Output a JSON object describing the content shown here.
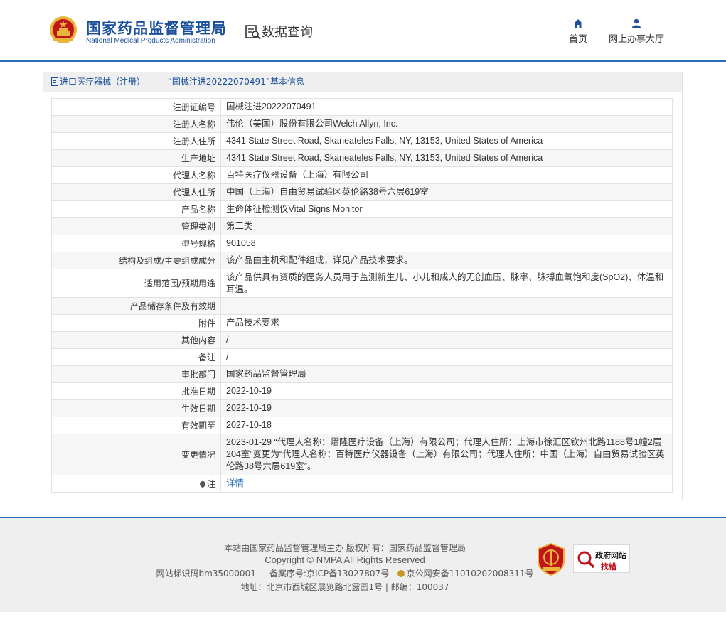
{
  "header": {
    "org_name_cn": "国家药品监督管理局",
    "org_name_en": "National Medical Products Administration",
    "section_title": "数据查询",
    "nav": {
      "home": "首页",
      "service_hall": "网上办事大厅"
    }
  },
  "panel": {
    "breadcrumb": "进口医疗器械（注册） —— “国械注进20222070491”基本信息"
  },
  "rows": [
    {
      "label": "注册证编号",
      "value": "国械注进20222070491"
    },
    {
      "label": "注册人名称",
      "value": "伟伦（美国）股份有限公司Welch Allyn, Inc."
    },
    {
      "label": "注册人住所",
      "value": "4341 State Street Road, Skaneateles Falls, NY, 13153, United States of America"
    },
    {
      "label": "生产地址",
      "value": "4341 State Street Road, Skaneateles Falls, NY, 13153, United States of America"
    },
    {
      "label": "代理人名称",
      "value": "百特医疗仪器设备（上海）有限公司"
    },
    {
      "label": "代理人住所",
      "value": "中国（上海）自由贸易试验区英伦路38号六层619室"
    },
    {
      "label": "产品名称",
      "value": "生命体征检测仪Vital Signs Monitor"
    },
    {
      "label": "管理类别",
      "value": "第二类"
    },
    {
      "label": "型号规格",
      "value": "901058"
    },
    {
      "label": "结构及组成/主要组成成分",
      "value": "该产品由主机和配件组成，详见产品技术要求。"
    },
    {
      "label": "适用范围/预期用途",
      "value": "该产品供具有资质的医务人员用于监测新生儿、小儿和成人的无创血压、脉率、脉搏血氧饱和度(SpO2)、体温和耳温。"
    },
    {
      "label": "产品储存条件及有效期",
      "value": ""
    },
    {
      "label": "附件",
      "value": "产品技术要求"
    },
    {
      "label": "其他内容",
      "value": "/"
    },
    {
      "label": "备注",
      "value": "/"
    },
    {
      "label": "审批部门",
      "value": "国家药品监督管理局"
    },
    {
      "label": "批准日期",
      "value": "2022-10-19"
    },
    {
      "label": "生效日期",
      "value": "2022-10-19"
    },
    {
      "label": "有效期至",
      "value": "2027-10-18"
    },
    {
      "label": "变更情况",
      "value": "2023-01-29 “代理人名称：熠隆医疗设备（上海）有限公司；代理人住所：上海市徐汇区钦州北路1188号1幢2层204室”变更为“代理人名称：百特医疗仪器设备（上海）有限公司；代理人住所：中国（上海）自由贸易试验区英伦路38号六层619室”。"
    },
    {
      "label": "注",
      "value": "详情"
    }
  ],
  "footer": {
    "line1": "本站由国家药品监督管理局主办 版权所有：国家药品监督管理局",
    "line2": "Copyright © NMPA All Rights Reserved",
    "site_id": "网站标识码bm35000001",
    "icp": "备案序号:京ICP备13027807号",
    "police": "京公网安备11010202008311号",
    "address": "地址：北京市西城区展览路北露园1号 | 邮编：100037",
    "gov_badge_title": "政府网站",
    "gov_badge_action": "找错"
  },
  "colors": {
    "brand_blue": "#1a4f9c",
    "accent_blue": "#2a6db5",
    "emblem_red": "#c0151b",
    "emblem_gold": "#e8b53a"
  }
}
